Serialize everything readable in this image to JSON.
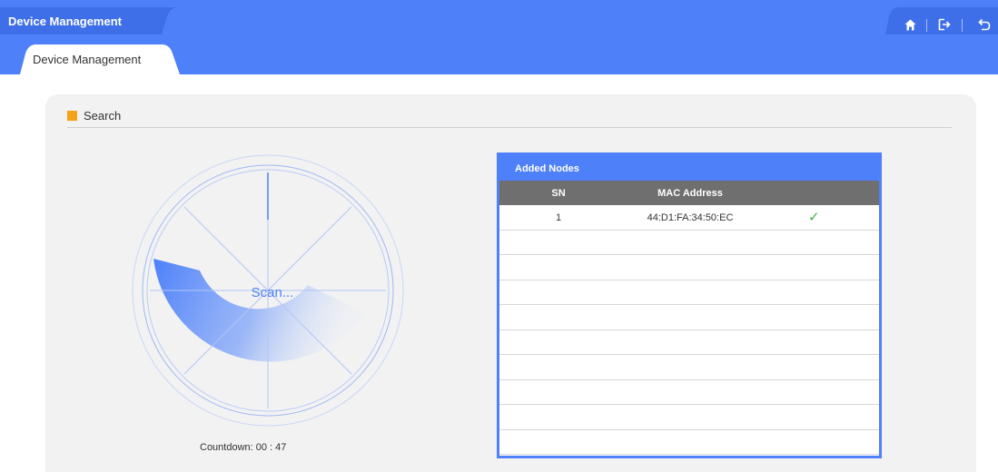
{
  "header": {
    "title": "Device Management",
    "accent_color": "#4d80f9",
    "icons": [
      "home-icon",
      "exit-icon",
      "back-icon"
    ]
  },
  "tabs": [
    {
      "label": "Device Management",
      "active": true
    }
  ],
  "search": {
    "title": "Search",
    "scan_label": "Scan...",
    "countdown_label": "Countdown: 00 : 47"
  },
  "nodes": {
    "title": "Added Nodes",
    "columns": [
      "SN",
      "MAC Address"
    ],
    "rows": [
      {
        "sn": "1",
        "mac": "44:D1:FA:34:50:EC",
        "status": "✓"
      }
    ]
  }
}
